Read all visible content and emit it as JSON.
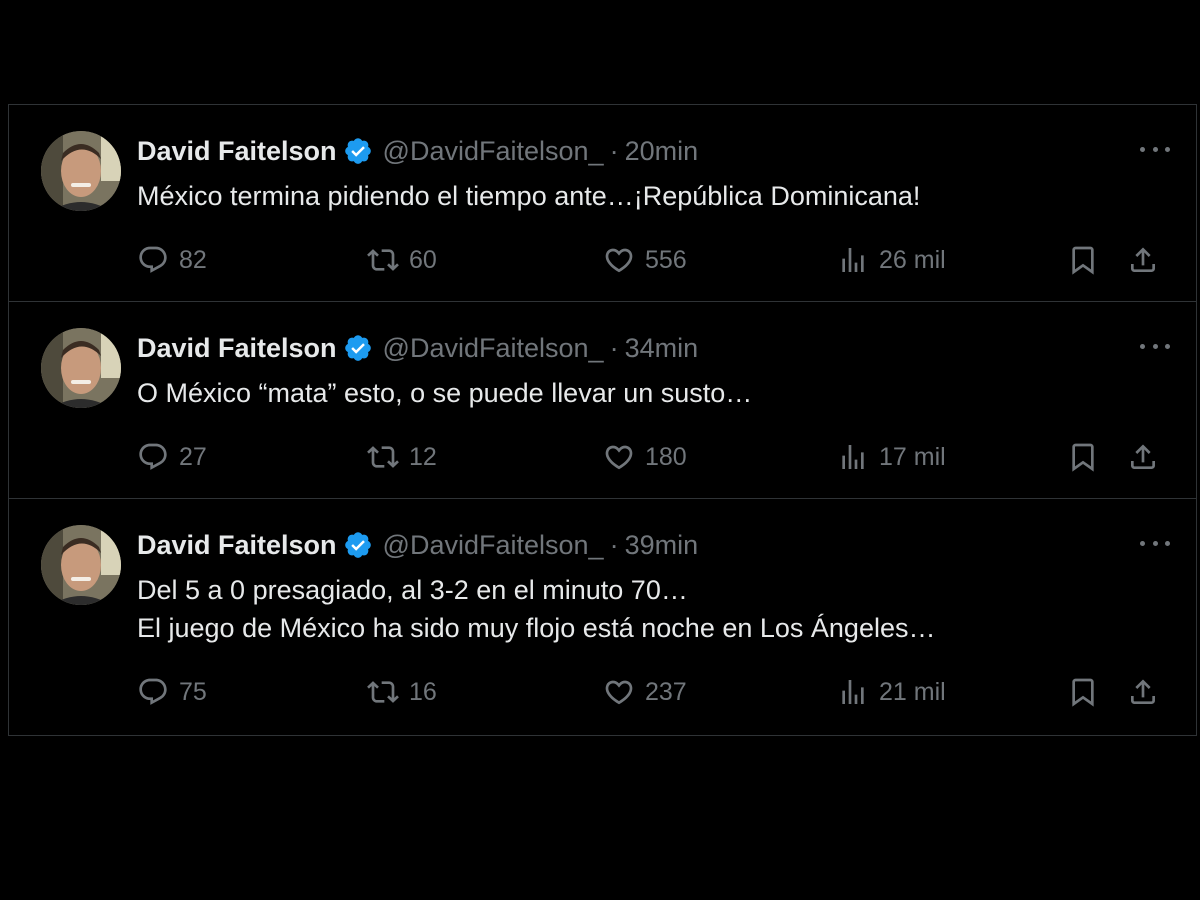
{
  "tweets": [
    {
      "name": "David Faitelson",
      "handle": "@DavidFaitelson_",
      "time": "20min",
      "lines": [
        "México termina pidiendo el tiempo ante…¡República Dominicana!"
      ],
      "replies": "82",
      "reposts": "60",
      "likes": "556",
      "views": "26 mil"
    },
    {
      "name": "David Faitelson",
      "handle": "@DavidFaitelson_",
      "time": "34min",
      "lines": [
        "O México “mata” esto, o se puede llevar un susto…"
      ],
      "replies": "27",
      "reposts": "12",
      "likes": "180",
      "views": "17 mil"
    },
    {
      "name": "David Faitelson",
      "handle": "@DavidFaitelson_",
      "time": "39min",
      "lines": [
        "Del 5 a 0 presagiado, al 3-2 en el minuto 70…",
        "El juego de México ha sido muy flojo está noche en Los Ángeles…"
      ],
      "replies": "75",
      "reposts": "16",
      "likes": "237",
      "views": "21 mil"
    }
  ],
  "icons": {
    "verified": "verified-badge-icon",
    "reply": "reply-icon",
    "repost": "repost-icon",
    "like": "heart-icon",
    "views": "views-icon",
    "bookmark": "bookmark-icon",
    "share": "share-icon",
    "more": "more-icon"
  },
  "colors": {
    "background": "#000000",
    "text": "#e7e9ea",
    "muted": "#71767b",
    "verified": "#1d9bf0",
    "divider": "#2f3336"
  }
}
